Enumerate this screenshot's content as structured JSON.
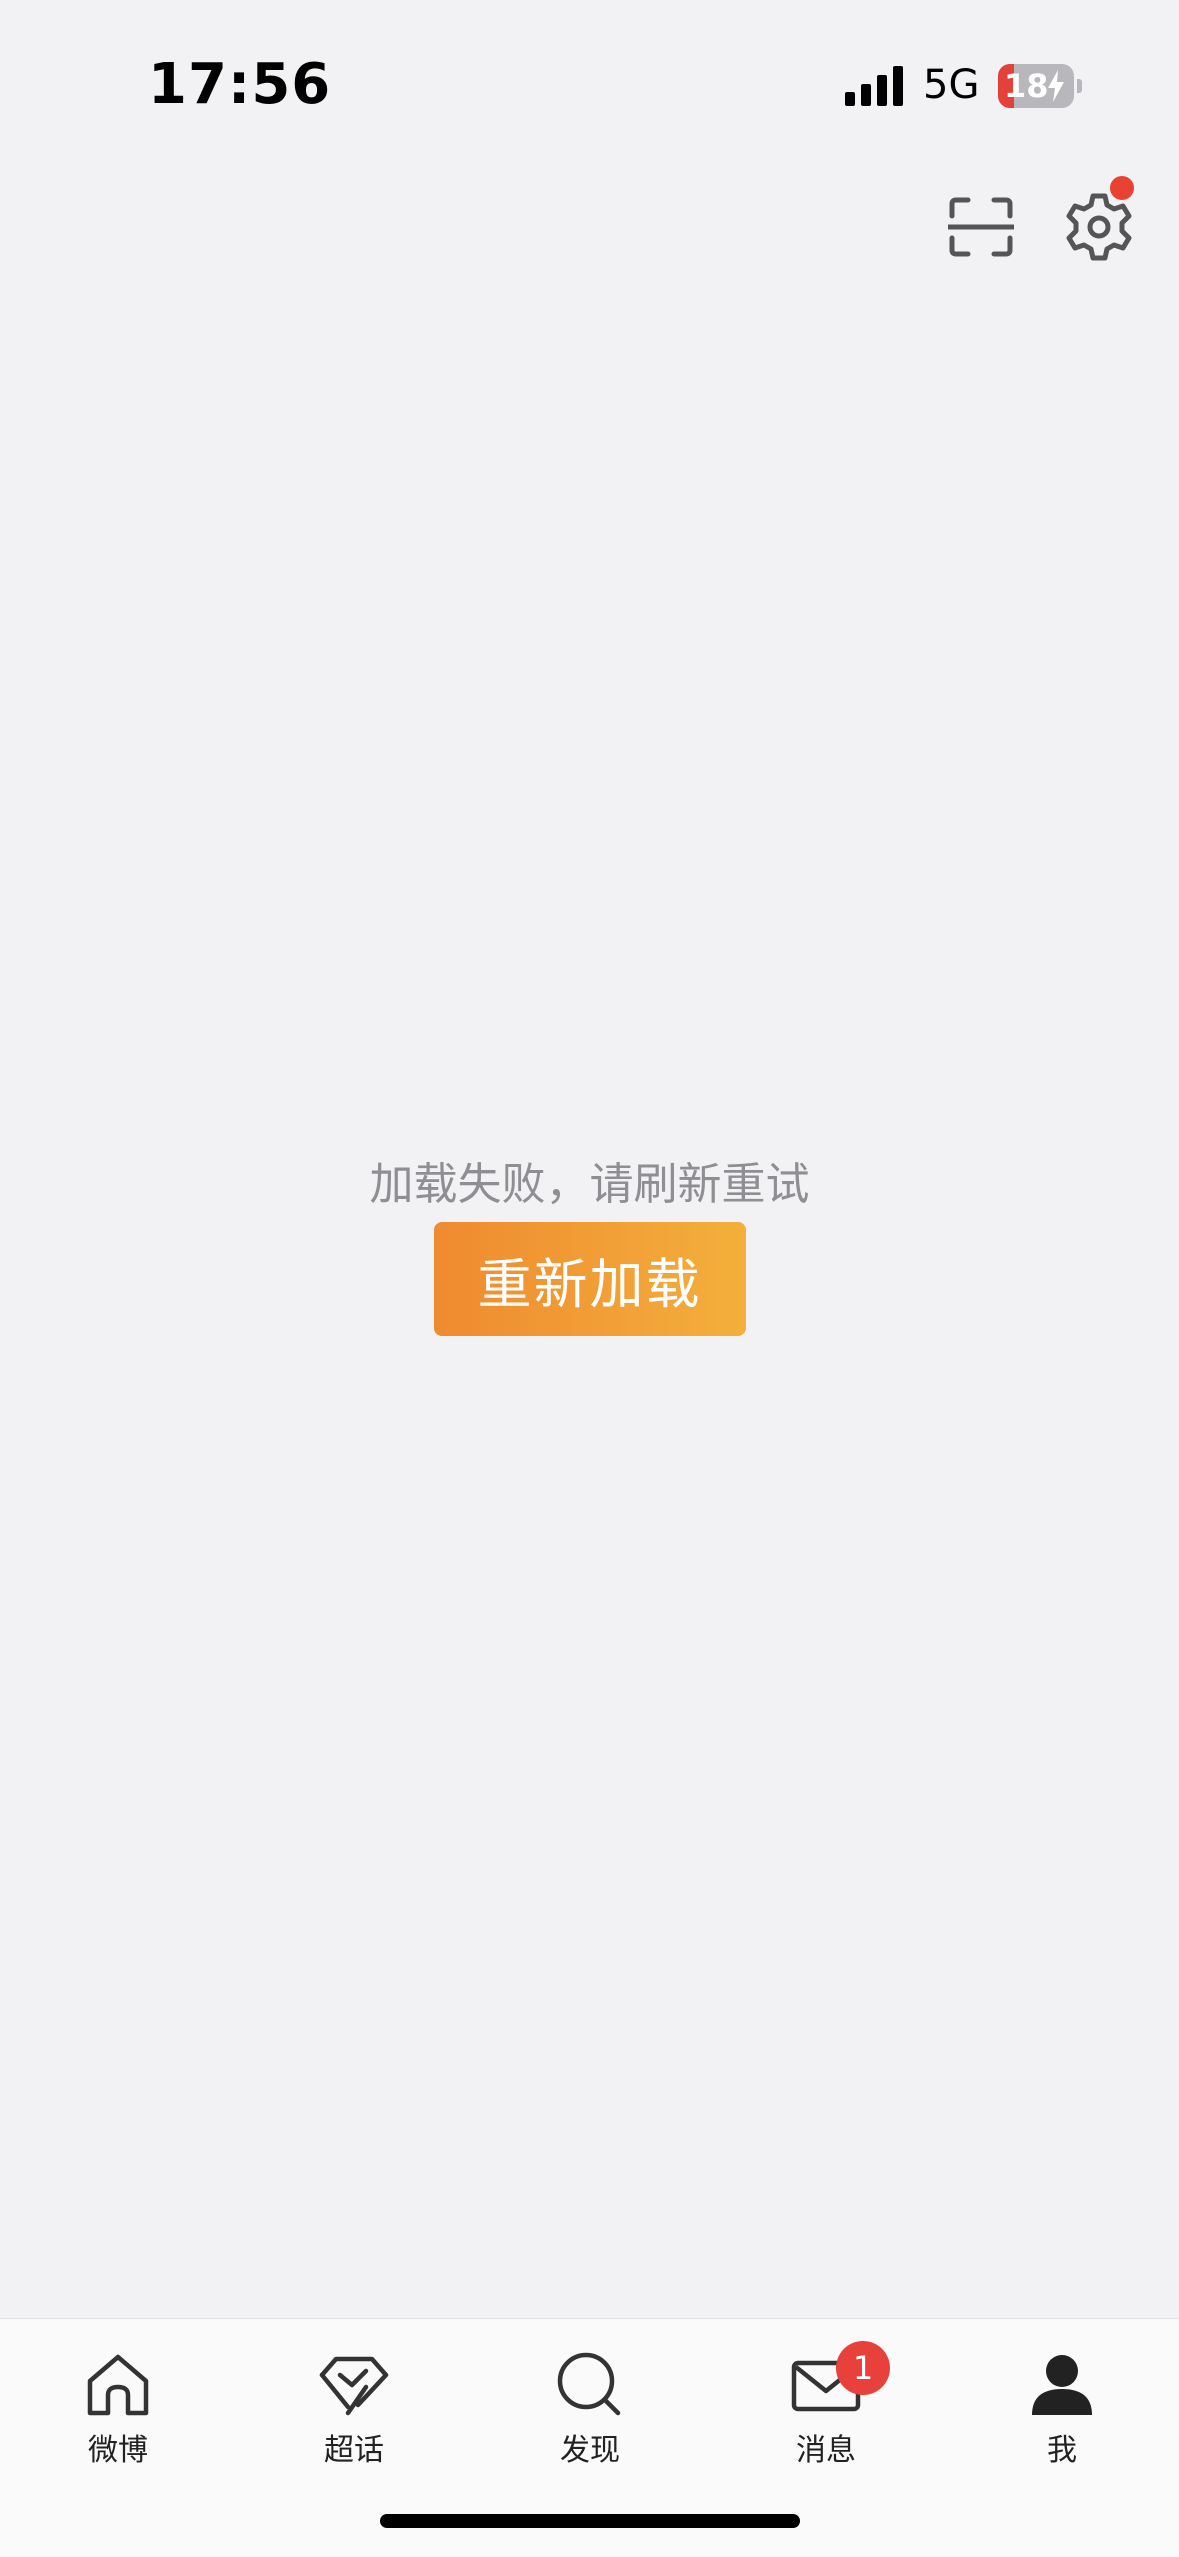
{
  "status_bar": {
    "time": "17:56",
    "network": "5G",
    "battery_level": "18"
  },
  "top_actions": {
    "scan_icon": "scan-icon",
    "settings_icon": "gear-icon",
    "settings_has_dot": true
  },
  "error": {
    "message": "加载失败，请刷新重试",
    "reload_label": "重新加载"
  },
  "colors": {
    "accent_start": "#ef8a30",
    "accent_end": "#f3b03b",
    "badge": "#e8403a"
  },
  "tab_bar": {
    "tabs": [
      {
        "label": "微博",
        "icon": "home-icon"
      },
      {
        "label": "超话",
        "icon": "diamond-icon"
      },
      {
        "label": "发现",
        "icon": "search-icon"
      },
      {
        "label": "消息",
        "icon": "mail-icon",
        "badge": "1"
      },
      {
        "label": "我",
        "icon": "profile-icon"
      }
    ]
  }
}
